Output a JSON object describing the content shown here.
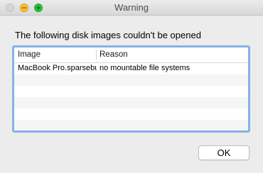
{
  "window": {
    "title": "Warning",
    "controls": {
      "close": {
        "icon": "close-icon",
        "color": "#d6d6d6"
      },
      "minimize": {
        "icon": "minimize-icon",
        "color": "#febc2e"
      },
      "zoom": {
        "icon": "zoom-icon",
        "color": "#28c840"
      }
    }
  },
  "dialog": {
    "message": "The following disk images couldn't be opened",
    "table": {
      "columns": [
        "Image",
        "Reason"
      ],
      "rows": [
        {
          "image": "MacBook Pro.sparsebu",
          "reason": "no mountable file systems"
        },
        {
          "image": "",
          "reason": ""
        },
        {
          "image": "",
          "reason": ""
        },
        {
          "image": "",
          "reason": ""
        },
        {
          "image": "",
          "reason": ""
        },
        {
          "image": "",
          "reason": ""
        }
      ]
    },
    "ok_label": "OK"
  },
  "colors": {
    "focus_ring": "#86b2e6",
    "row_alt": "#f4f5f5",
    "window_bg": "#ececec"
  }
}
